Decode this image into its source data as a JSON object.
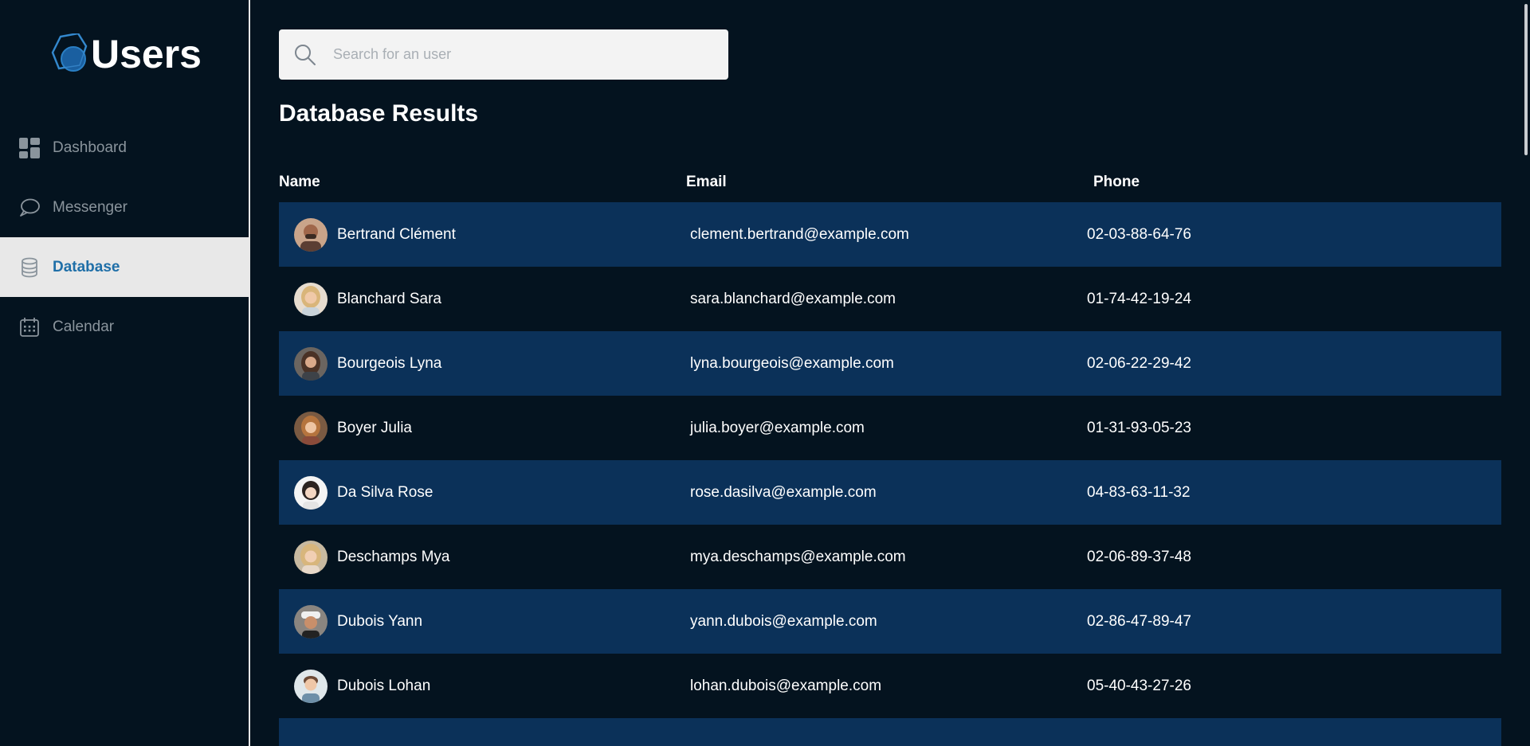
{
  "brand": {
    "title": "Users",
    "logo_icon": "hexagon-circle-logo-icon",
    "accent_color": "#1f6fa8"
  },
  "sidebar": {
    "items": [
      {
        "label": "Dashboard",
        "icon": "dashboard-icon",
        "active": false
      },
      {
        "label": "Messenger",
        "icon": "chat-bubble-icon",
        "active": false
      },
      {
        "label": "Database",
        "icon": "database-icon",
        "active": true
      },
      {
        "label": "Calendar",
        "icon": "calendar-icon",
        "active": false
      }
    ]
  },
  "search": {
    "placeholder": "Search for an user",
    "value": "",
    "icon": "search-icon"
  },
  "main": {
    "title": "Database Results"
  },
  "table": {
    "columns": [
      "Name",
      "Email",
      "Phone"
    ],
    "row_highlight_color": "#0b3159",
    "rows": [
      {
        "name": "Bertrand Clément",
        "email": "clement.bertrand@example.com",
        "phone": "02-03-88-64-76"
      },
      {
        "name": "Blanchard Sara",
        "email": "sara.blanchard@example.com",
        "phone": "01-74-42-19-24"
      },
      {
        "name": "Bourgeois Lyna",
        "email": "lyna.bourgeois@example.com",
        "phone": "02-06-22-29-42"
      },
      {
        "name": "Boyer Julia",
        "email": "julia.boyer@example.com",
        "phone": "01-31-93-05-23"
      },
      {
        "name": "Da Silva Rose",
        "email": "rose.dasilva@example.com",
        "phone": "04-83-63-11-32"
      },
      {
        "name": "Deschamps Mya",
        "email": "mya.deschamps@example.com",
        "phone": "02-06-89-37-48"
      },
      {
        "name": "Dubois Yann",
        "email": "yann.dubois@example.com",
        "phone": "02-86-47-89-47"
      },
      {
        "name": "Dubois Lohan",
        "email": "lohan.dubois@example.com",
        "phone": "05-40-43-27-26"
      }
    ]
  }
}
